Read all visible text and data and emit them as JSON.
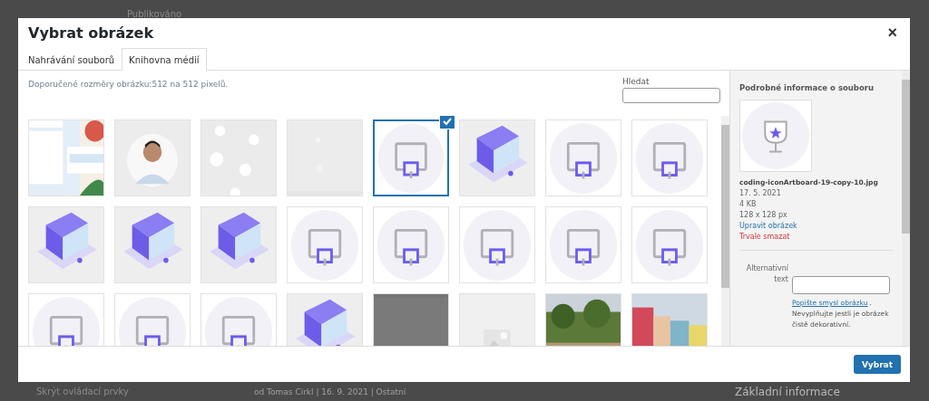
{
  "background": {
    "status": "Publikováno",
    "hide_controls": "Skrýt ovládací prvky",
    "post_meta": "od Tomas Cirkl | 16. 9. 2021 | Ostatní",
    "panel_title": "Základní informace"
  },
  "modal": {
    "title": "Vybrat obrázek",
    "close": "×"
  },
  "tabs": [
    {
      "label": "Nahrávání souborů",
      "selected": false
    },
    {
      "label": "Knihovna médií",
      "selected": true
    }
  ],
  "hint": "Doporučené rozměry obrázku:512 na 512 pixelů.",
  "search": {
    "label": "Hledat"
  },
  "media": [
    {
      "kind": "picture",
      "selected": false
    },
    {
      "kind": "picture",
      "selected": false
    },
    {
      "kind": "picture",
      "selected": false
    },
    {
      "kind": "picture",
      "selected": false
    },
    {
      "kind": "picture",
      "selected": true
    },
    {
      "kind": "picture",
      "selected": false
    },
    {
      "kind": "picture",
      "selected": false
    },
    {
      "kind": "picture",
      "selected": false
    },
    {
      "kind": "picture",
      "selected": false
    },
    {
      "kind": "picture",
      "selected": false
    },
    {
      "kind": "picture",
      "selected": false
    },
    {
      "kind": "picture",
      "selected": false
    },
    {
      "kind": "picture",
      "selected": false
    },
    {
      "kind": "picture",
      "selected": false
    },
    {
      "kind": "picture",
      "selected": false
    },
    {
      "kind": "picture",
      "selected": false
    },
    {
      "kind": "picture",
      "selected": false
    },
    {
      "kind": "picture",
      "selected": false
    },
    {
      "kind": "picture",
      "selected": false
    },
    {
      "kind": "picture",
      "selected": false
    },
    {
      "kind": "picture",
      "selected": false
    },
    {
      "kind": "picture",
      "selected": false
    },
    {
      "kind": "picture",
      "selected": false
    },
    {
      "kind": "picture",
      "selected": false
    }
  ],
  "details": {
    "heading": "Podrobné informace o souboru",
    "filename": "coding-iconArtboard-19-copy-10.jpg",
    "date": "17. 5. 2021",
    "size": "4 KB",
    "dimensions": "128 x 128 px",
    "edit_link": "Upravit obrázek",
    "delete_link": "Trvale smazat",
    "alt_label": "Alternativní text",
    "alt_help_link": "Popište smysl obrázku",
    "alt_help_link_end": ".",
    "alt_help": "Nevyplňujte jestli je obrázek čistě dekorativní."
  },
  "select_button": "Vybrat"
}
